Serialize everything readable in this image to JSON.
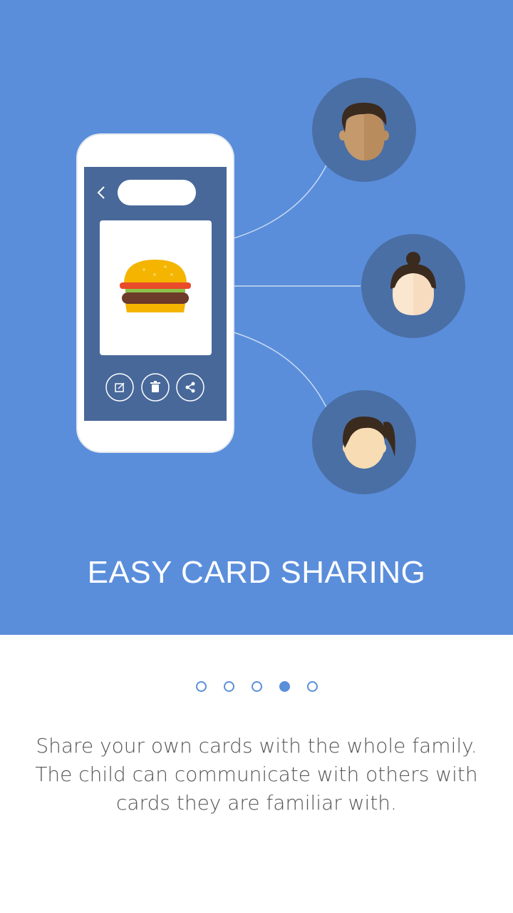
{
  "title": "EASY CARD SHARING",
  "description": {
    "line1": "Share your own cards with the whole family.",
    "line2": "The child can communicate with others with",
    "line3": "cards they are familiar with."
  },
  "pagination": {
    "total": 5,
    "active_index": 3
  },
  "colors": {
    "hero_background": "#5a8edb",
    "circle": "#4a6fa5",
    "phone_screen": "#48689a",
    "accent": "#5a8edb"
  },
  "icons": {
    "back": "chevron-left-icon",
    "edit": "edit-icon",
    "delete": "trash-icon",
    "share": "share-icon",
    "card_image": "burger-icon"
  }
}
